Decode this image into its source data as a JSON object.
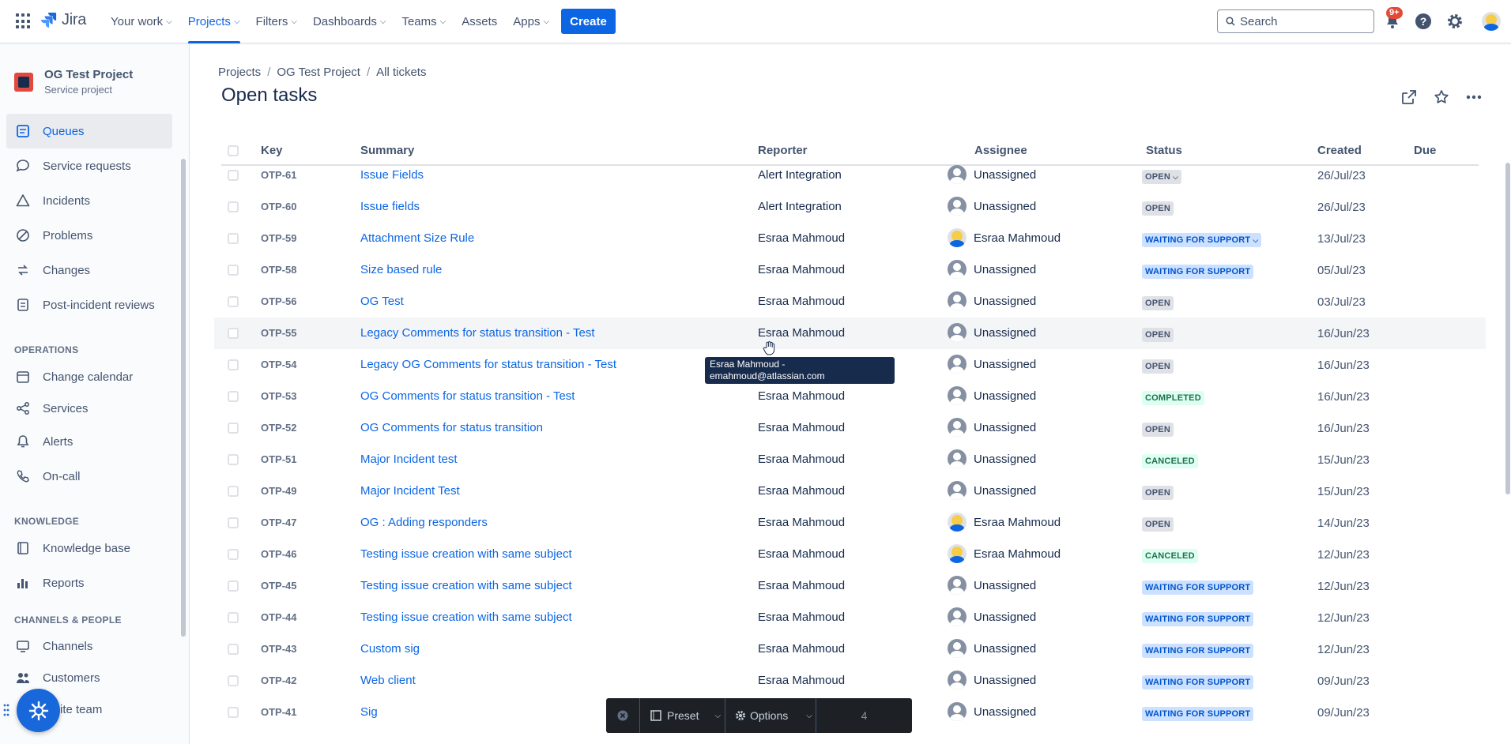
{
  "app": {
    "name": "Jira"
  },
  "topnav": {
    "items": [
      {
        "label": "Your work"
      },
      {
        "label": "Projects"
      },
      {
        "label": "Filters"
      },
      {
        "label": "Dashboards"
      },
      {
        "label": "Teams"
      },
      {
        "label": "Assets"
      },
      {
        "label": "Apps"
      }
    ],
    "create_label": "Create",
    "search_placeholder": "Search",
    "notifications_badge": "9+"
  },
  "sidebar": {
    "project_name": "OG Test Project",
    "project_type": "Service project",
    "items": [
      {
        "label": "Queues"
      },
      {
        "label": "Service requests"
      },
      {
        "label": "Incidents"
      },
      {
        "label": "Problems"
      },
      {
        "label": "Changes"
      },
      {
        "label": "Post-incident reviews"
      }
    ],
    "sections": [
      {
        "title": "OPERATIONS",
        "items": [
          {
            "label": "Change calendar"
          },
          {
            "label": "Services"
          },
          {
            "label": "Alerts"
          },
          {
            "label": "On-call"
          }
        ]
      },
      {
        "title": "KNOWLEDGE",
        "items": [
          {
            "label": "Knowledge base"
          },
          {
            "label": "Reports"
          }
        ]
      },
      {
        "title": "CHANNELS & PEOPLE",
        "items": [
          {
            "label": "Channels"
          },
          {
            "label": "Customers"
          },
          {
            "label": "ite team"
          }
        ]
      }
    ]
  },
  "breadcrumbs": [
    "Projects",
    "OG Test Project",
    "All tickets"
  ],
  "page_title": "Open tasks",
  "table": {
    "columns": [
      "Key",
      "Summary",
      "Reporter",
      "Assignee",
      "Status",
      "Created",
      "Due"
    ],
    "rows": [
      {
        "key": "OTP-61",
        "summary": "Issue Fields",
        "reporter": "Alert Integration",
        "assignee": "Unassigned",
        "status": "OPEN",
        "created": "26/Jul/23"
      },
      {
        "key": "OTP-60",
        "summary": "Issue fields",
        "reporter": "Alert Integration",
        "assignee": "Unassigned",
        "status": "OPEN",
        "created": "26/Jul/23"
      },
      {
        "key": "OTP-59",
        "summary": "Attachment Size Rule",
        "reporter": "Esraa Mahmoud",
        "assignee": "Esraa Mahmoud",
        "status": "WAITING FOR SUPPORT",
        "created": "13/Jul/23"
      },
      {
        "key": "OTP-58",
        "summary": "Size based rule",
        "reporter": "Esraa Mahmoud",
        "assignee": "Unassigned",
        "status": "WAITING FOR SUPPORT",
        "created": "05/Jul/23"
      },
      {
        "key": "OTP-56",
        "summary": "OG Test",
        "reporter": "Esraa Mahmoud",
        "assignee": "Unassigned",
        "status": "OPEN",
        "created": "03/Jul/23"
      },
      {
        "key": "OTP-55",
        "summary": "Legacy Comments for status transition - Test",
        "reporter": "Esraa Mahmoud",
        "assignee": "Unassigned",
        "status": "OPEN",
        "created": "16/Jun/23"
      },
      {
        "key": "OTP-54",
        "summary": "Legacy OG Comments for status transition - Test",
        "reporter": "",
        "assignee": "Unassigned",
        "status": "OPEN",
        "created": "16/Jun/23"
      },
      {
        "key": "OTP-53",
        "summary": "OG Comments for status transition - Test",
        "reporter": "Esraa Mahmoud",
        "assignee": "Unassigned",
        "status": "COMPLETED",
        "created": "16/Jun/23"
      },
      {
        "key": "OTP-52",
        "summary": "OG Comments for status transition",
        "reporter": "Esraa Mahmoud",
        "assignee": "Unassigned",
        "status": "OPEN",
        "created": "16/Jun/23"
      },
      {
        "key": "OTP-51",
        "summary": "Major Incident test",
        "reporter": "Esraa Mahmoud",
        "assignee": "Unassigned",
        "status": "CANCELED",
        "created": "15/Jun/23"
      },
      {
        "key": "OTP-49",
        "summary": "Major Incident Test",
        "reporter": "Esraa Mahmoud",
        "assignee": "Unassigned",
        "status": "OPEN",
        "created": "15/Jun/23"
      },
      {
        "key": "OTP-47",
        "summary": "OG : Adding responders",
        "reporter": "Esraa Mahmoud",
        "assignee": "Esraa Mahmoud",
        "status": "OPEN",
        "created": "14/Jun/23"
      },
      {
        "key": "OTP-46",
        "summary": "Testing issue creation with same subject",
        "reporter": "Esraa Mahmoud",
        "assignee": "Esraa Mahmoud",
        "status": "CANCELED",
        "created": "12/Jun/23"
      },
      {
        "key": "OTP-45",
        "summary": "Testing issue creation with same subject",
        "reporter": "Esraa Mahmoud",
        "assignee": "Unassigned",
        "status": "WAITING FOR SUPPORT",
        "created": "12/Jun/23"
      },
      {
        "key": "OTP-44",
        "summary": "Testing issue creation with same subject",
        "reporter": "Esraa Mahmoud",
        "assignee": "Unassigned",
        "status": "WAITING FOR SUPPORT",
        "created": "12/Jun/23"
      },
      {
        "key": "OTP-43",
        "summary": "Custom sig",
        "reporter": "Esraa Mahmoud",
        "assignee": "Unassigned",
        "status": "WAITING FOR SUPPORT",
        "created": "12/Jun/23"
      },
      {
        "key": "OTP-42",
        "summary": "Web client",
        "reporter": "Esraa Mahmoud",
        "assignee": "Unassigned",
        "status": "WAITING FOR SUPPORT",
        "created": "09/Jun/23"
      },
      {
        "key": "OTP-41",
        "summary": "Sig",
        "reporter": "",
        "assignee": "Unassigned",
        "status": "WAITING FOR SUPPORT",
        "created": "09/Jun/23"
      }
    ]
  },
  "tooltip": {
    "line1": "Esraa Mahmoud -",
    "line2": "emahmoud@atlassian.com"
  },
  "bottom_bar": {
    "preset_label": "Preset",
    "options_label": "Options",
    "count": "4"
  },
  "colors": {
    "accent": "#0c66e4",
    "text": "#172b4d",
    "subtle": "#44546f"
  }
}
